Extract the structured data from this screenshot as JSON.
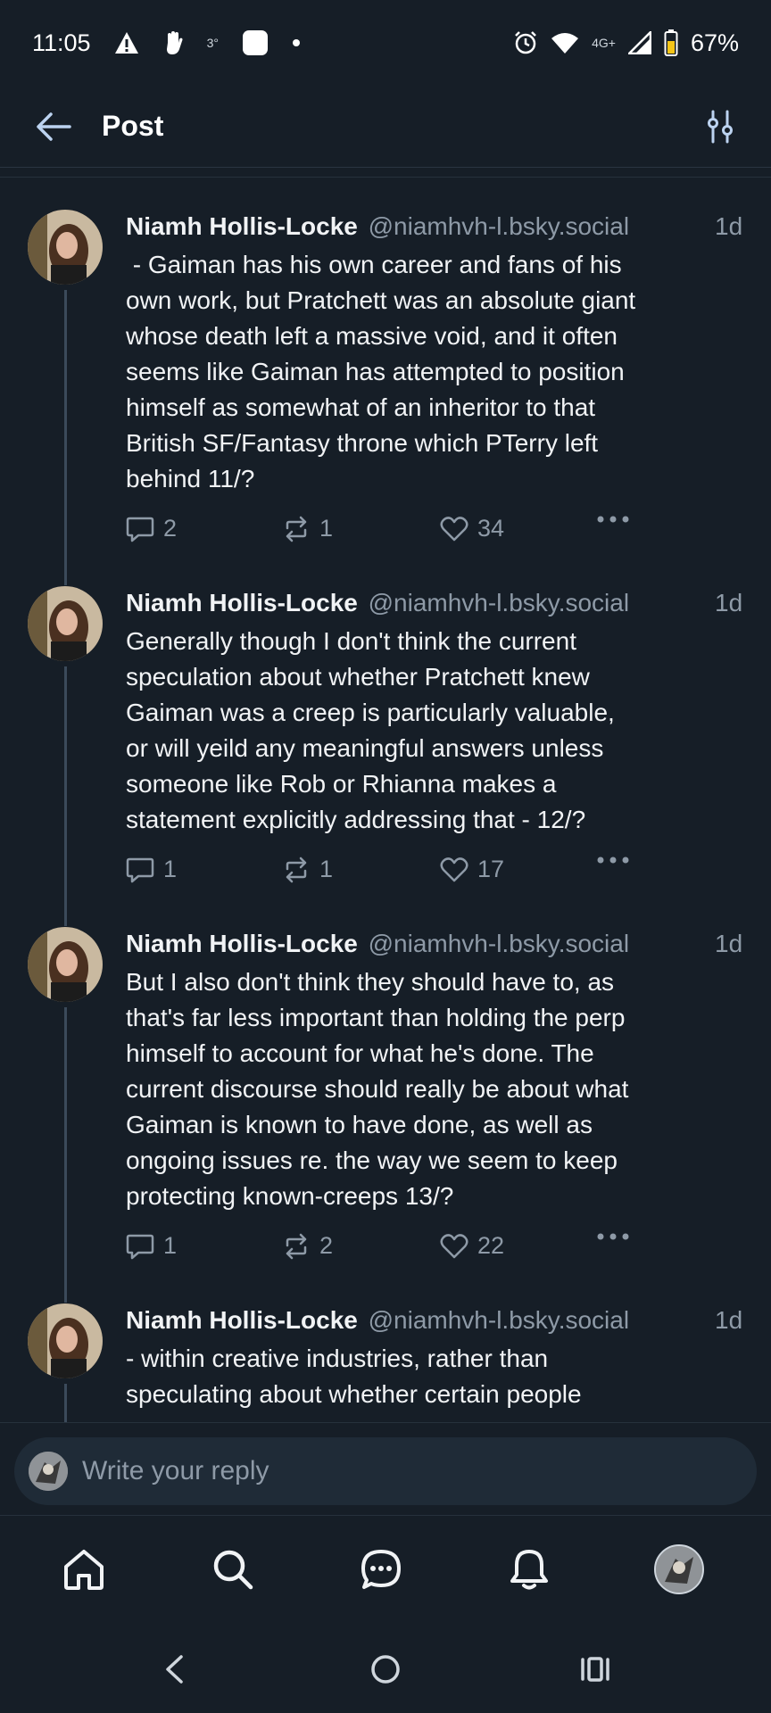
{
  "status_bar": {
    "time": "11:05",
    "temp": "3°",
    "network": "4G+",
    "battery": "67%"
  },
  "header": {
    "title": "Post"
  },
  "posts": [
    {
      "name": "Niamh Hollis-Locke",
      "handle": "@niamhvh-l.bsky.social",
      "time": "1d",
      "text": " - Gaiman has his own career and fans of his\nown work, but Pratchett was an absolute giant\nwhose death left a massive void, and it often\nseems like Gaiman has attempted to position\nhimself as somewhat of an inheritor to that\nBritish SF/Fantasy throne which PTerry left\nbehind 11/?",
      "replies": "2",
      "reposts": "1",
      "likes": "34"
    },
    {
      "name": "Niamh Hollis-Locke",
      "handle": "@niamhvh-l.bsky.social",
      "time": "1d",
      "text": "Generally though I don't think the current\nspeculation about whether Pratchett knew\nGaiman was a creep is particularly valuable,\nor will yeild any meaningful answers unless\nsomeone like Rob or Rhianna makes a\nstatement explicitly addressing that - 12/?",
      "replies": "1",
      "reposts": "1",
      "likes": "17"
    },
    {
      "name": "Niamh Hollis-Locke",
      "handle": "@niamhvh-l.bsky.social",
      "time": "1d",
      "text": "But I also don't think they should have to, as\nthat's far less important than holding the perp\nhimself to account for what he's done. The\ncurrent discourse should really be about what\nGaiman is known to have done, as well as\nongoing issues re. the way we seem to keep\nprotecting known-creeps 13/?",
      "replies": "1",
      "reposts": "2",
      "likes": "22"
    },
    {
      "name": "Niamh Hollis-Locke",
      "handle": "@niamhvh-l.bsky.social",
      "time": "1d",
      "text": "- within creative industries, rather than\nspeculating about whether certain people"
    }
  ],
  "reply_bar": {
    "placeholder": "Write your reply"
  },
  "icons": {
    "back": "arrow-left-icon",
    "filter": "sliders-icon",
    "reply": "comment-icon",
    "repost": "repost-icon",
    "like": "heart-icon",
    "more": "ellipsis-icon"
  },
  "colors": {
    "background": "#161e27",
    "text": "#f1f3f5",
    "muted": "#8e9aa7",
    "thread_line": "#3b4a5a"
  }
}
